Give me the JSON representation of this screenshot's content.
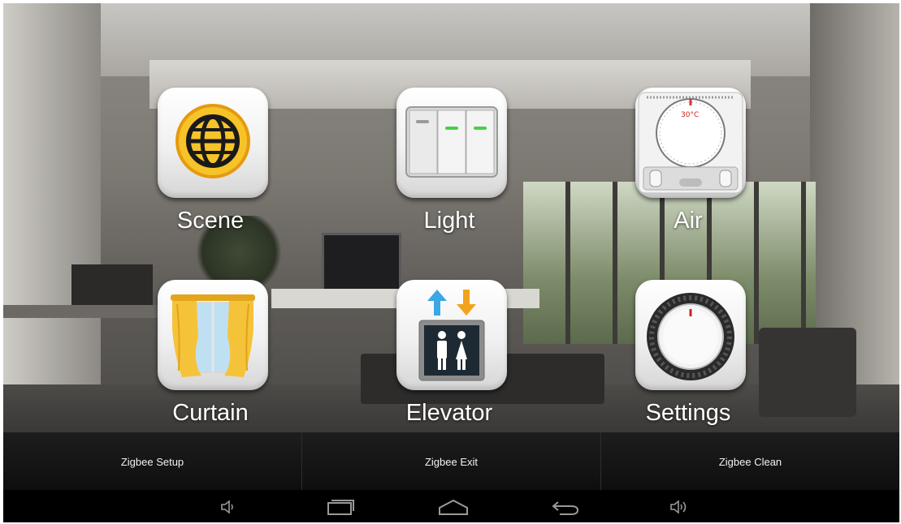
{
  "home": {
    "tiles": [
      {
        "label": "Scene",
        "icon": "globe-icon"
      },
      {
        "label": "Light",
        "icon": "light-switch-icon"
      },
      {
        "label": "Air",
        "icon": "thermostat-icon"
      },
      {
        "label": "Curtain",
        "icon": "curtain-icon"
      },
      {
        "label": "Elevator",
        "icon": "elevator-icon"
      },
      {
        "label": "Settings",
        "icon": "dial-icon"
      }
    ],
    "thermostat_readout": "30°C"
  },
  "action_bar": {
    "items": [
      "Zigbee Setup",
      "Zigbee Exit",
      "Zigbee Clean"
    ]
  },
  "nav_bar": {
    "buttons": [
      "volume-down-icon",
      "recent-apps-icon",
      "home-icon",
      "back-icon",
      "volume-up-icon"
    ]
  },
  "colors": {
    "scene_ring": "#f3b21b",
    "switch_led": "#46d146",
    "arrow_up": "#3aa7e6",
    "arrow_down": "#f3a21b",
    "curtain": "#f5c33a",
    "action_bar_bg": "#151515"
  }
}
